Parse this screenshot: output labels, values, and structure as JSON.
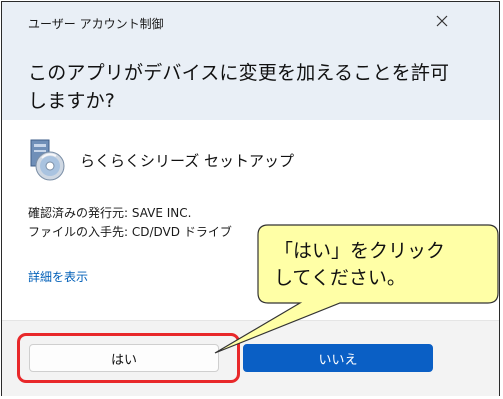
{
  "dialog": {
    "title": "ユーザー アカウント制御",
    "question_line1": "このアプリがデバイスに変更を加えることを許可しますか?",
    "app_name": "らくらくシリーズ セットアップ",
    "publisher": "確認済みの発行元: SAVE INC.",
    "source": "ファイルの入手先: CD/DVD ドライブ",
    "details_link": "詳細を表示",
    "yes_label": "はい",
    "no_label": "いいえ"
  },
  "annotation": {
    "line1": "「はい」をクリック",
    "line2": "してください。"
  },
  "icons": {
    "close": "close-icon",
    "app": "setup-disc-icon"
  },
  "colors": {
    "header_bg": "#e9eff6",
    "primary_button": "#0a5fc5",
    "callout_fill": "#ffffa6",
    "highlight": "#e8282a"
  }
}
